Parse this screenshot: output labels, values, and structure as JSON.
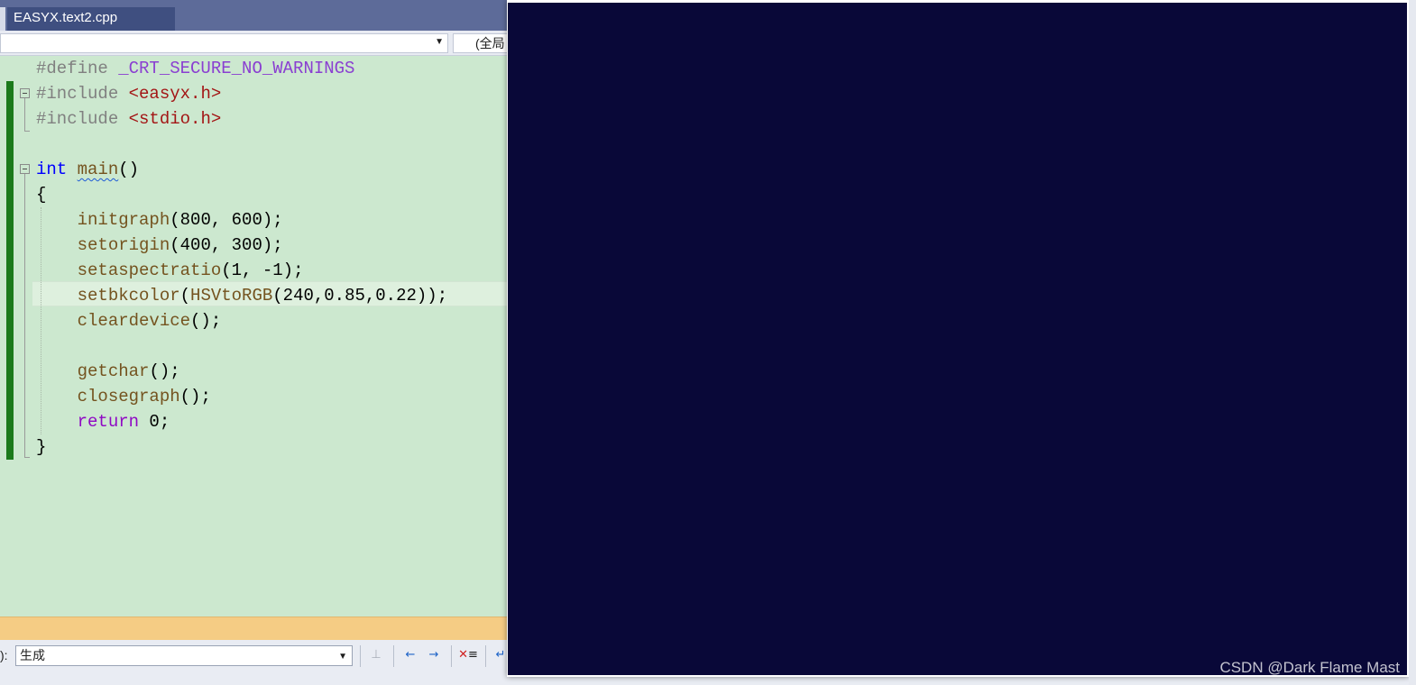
{
  "tabs": {
    "active_label": "EASYX.text2.cpp"
  },
  "navbar": {
    "scope_label": "(全局"
  },
  "editor": {
    "lines": [
      [
        {
          "t": "#define ",
          "c": "prep"
        },
        {
          "t": "_CRT_SECURE_NO_WARNINGS",
          "c": "macro"
        }
      ],
      [
        {
          "t": "#include ",
          "c": "prep"
        },
        {
          "t": "<easyx.h>",
          "c": "str"
        }
      ],
      [
        {
          "t": "#include ",
          "c": "prep"
        },
        {
          "t": "<stdio.h>",
          "c": "str"
        }
      ],
      [],
      [
        {
          "t": "int",
          "c": "kw"
        },
        {
          "t": " ",
          "c": "pun"
        },
        {
          "t": "main",
          "c": "fn",
          "squiggle": true
        },
        {
          "t": "()",
          "c": "pun"
        }
      ],
      [
        {
          "t": "{",
          "c": "pun"
        }
      ],
      [
        {
          "t": "    ",
          "c": "pun"
        },
        {
          "t": "initgraph",
          "c": "fn"
        },
        {
          "t": "(800, 600);",
          "c": "pun"
        }
      ],
      [
        {
          "t": "    ",
          "c": "pun"
        },
        {
          "t": "setorigin",
          "c": "fn"
        },
        {
          "t": "(400, 300);",
          "c": "pun"
        }
      ],
      [
        {
          "t": "    ",
          "c": "pun"
        },
        {
          "t": "setaspectratio",
          "c": "fn"
        },
        {
          "t": "(1, -1);",
          "c": "pun"
        }
      ],
      [
        {
          "t": "    ",
          "c": "pun"
        },
        {
          "t": "setbkcolor",
          "c": "fn"
        },
        {
          "t": "(",
          "c": "pun"
        },
        {
          "t": "HSVtoRGB",
          "c": "fn"
        },
        {
          "t": "(240,0.85,0.22));",
          "c": "pun"
        }
      ],
      [
        {
          "t": "    ",
          "c": "pun"
        },
        {
          "t": "cleardevice",
          "c": "fn"
        },
        {
          "t": "();",
          "c": "pun"
        }
      ],
      [],
      [
        {
          "t": "    ",
          "c": "pun"
        },
        {
          "t": "getchar",
          "c": "fn"
        },
        {
          "t": "();",
          "c": "pun"
        }
      ],
      [
        {
          "t": "    ",
          "c": "pun"
        },
        {
          "t": "closegraph",
          "c": "fn"
        },
        {
          "t": "();",
          "c": "pun"
        }
      ],
      [
        {
          "t": "    ",
          "c": "pun"
        },
        {
          "t": "return",
          "c": "kw2"
        },
        {
          "t": " 0;",
          "c": "pun"
        }
      ],
      [
        {
          "t": "}",
          "c": "pun"
        }
      ]
    ]
  },
  "output": {
    "source_prefix": "):",
    "source_value": "生成"
  },
  "toolbar_icons": [
    "find-message-icon",
    "align-left-icon",
    "align-right-icon",
    "clear-all-icon",
    "word-wrap-icon"
  ],
  "graphics_window": {
    "background_color": "#090838"
  },
  "watermark": "CSDN @Dark Flame Mast"
}
